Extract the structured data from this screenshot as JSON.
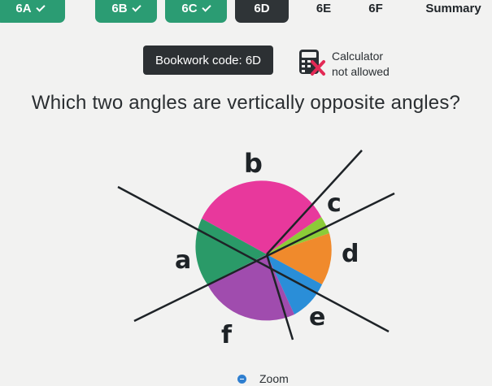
{
  "tabs": [
    {
      "label": "6A",
      "state": "done"
    },
    {
      "label": "6B",
      "state": "done"
    },
    {
      "label": "6C",
      "state": "done"
    },
    {
      "label": "6D",
      "state": "active"
    },
    {
      "label": "6E",
      "state": "upcoming"
    },
    {
      "label": "6F",
      "state": "upcoming"
    },
    {
      "label": "Summary",
      "state": "upcoming"
    }
  ],
  "bookwork": {
    "label": "Bookwork code: 6D"
  },
  "calculator": {
    "line1": "Calculator",
    "line2": "not allowed",
    "icon": "calculator-crossed-icon"
  },
  "question": {
    "text": "Which two angles are vertically opposite angles?"
  },
  "diagram": {
    "labels": {
      "a": "a",
      "b": "b",
      "c": "c",
      "d": "d",
      "e": "e",
      "f": "f"
    },
    "colors": {
      "a": "#2a9a68",
      "b": "#e8389c",
      "c": "#8ccb38",
      "d": "#f08a2c",
      "e": "#2a8ed8",
      "f": "#a04cae"
    }
  },
  "zoom": {
    "label": "Zoom"
  }
}
